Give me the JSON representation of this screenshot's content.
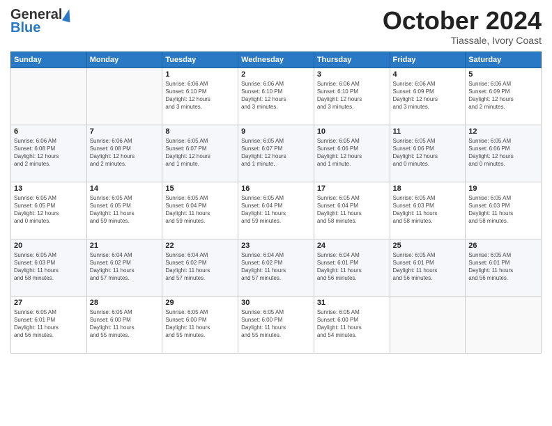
{
  "header": {
    "logo_general": "General",
    "logo_blue": "Blue",
    "month_title": "October 2024",
    "subtitle": "Tiassale, Ivory Coast"
  },
  "days_of_week": [
    "Sunday",
    "Monday",
    "Tuesday",
    "Wednesday",
    "Thursday",
    "Friday",
    "Saturday"
  ],
  "weeks": [
    [
      {
        "day": "",
        "info": ""
      },
      {
        "day": "",
        "info": ""
      },
      {
        "day": "1",
        "info": "Sunrise: 6:06 AM\nSunset: 6:10 PM\nDaylight: 12 hours\nand 3 minutes."
      },
      {
        "day": "2",
        "info": "Sunrise: 6:06 AM\nSunset: 6:10 PM\nDaylight: 12 hours\nand 3 minutes."
      },
      {
        "day": "3",
        "info": "Sunrise: 6:06 AM\nSunset: 6:10 PM\nDaylight: 12 hours\nand 3 minutes."
      },
      {
        "day": "4",
        "info": "Sunrise: 6:06 AM\nSunset: 6:09 PM\nDaylight: 12 hours\nand 3 minutes."
      },
      {
        "day": "5",
        "info": "Sunrise: 6:06 AM\nSunset: 6:09 PM\nDaylight: 12 hours\nand 2 minutes."
      }
    ],
    [
      {
        "day": "6",
        "info": "Sunrise: 6:06 AM\nSunset: 6:08 PM\nDaylight: 12 hours\nand 2 minutes."
      },
      {
        "day": "7",
        "info": "Sunrise: 6:06 AM\nSunset: 6:08 PM\nDaylight: 12 hours\nand 2 minutes."
      },
      {
        "day": "8",
        "info": "Sunrise: 6:05 AM\nSunset: 6:07 PM\nDaylight: 12 hours\nand 1 minute."
      },
      {
        "day": "9",
        "info": "Sunrise: 6:05 AM\nSunset: 6:07 PM\nDaylight: 12 hours\nand 1 minute."
      },
      {
        "day": "10",
        "info": "Sunrise: 6:05 AM\nSunset: 6:06 PM\nDaylight: 12 hours\nand 1 minute."
      },
      {
        "day": "11",
        "info": "Sunrise: 6:05 AM\nSunset: 6:06 PM\nDaylight: 12 hours\nand 0 minutes."
      },
      {
        "day": "12",
        "info": "Sunrise: 6:05 AM\nSunset: 6:06 PM\nDaylight: 12 hours\nand 0 minutes."
      }
    ],
    [
      {
        "day": "13",
        "info": "Sunrise: 6:05 AM\nSunset: 6:05 PM\nDaylight: 12 hours\nand 0 minutes."
      },
      {
        "day": "14",
        "info": "Sunrise: 6:05 AM\nSunset: 6:05 PM\nDaylight: 11 hours\nand 59 minutes."
      },
      {
        "day": "15",
        "info": "Sunrise: 6:05 AM\nSunset: 6:04 PM\nDaylight: 11 hours\nand 59 minutes."
      },
      {
        "day": "16",
        "info": "Sunrise: 6:05 AM\nSunset: 6:04 PM\nDaylight: 11 hours\nand 59 minutes."
      },
      {
        "day": "17",
        "info": "Sunrise: 6:05 AM\nSunset: 6:04 PM\nDaylight: 11 hours\nand 58 minutes."
      },
      {
        "day": "18",
        "info": "Sunrise: 6:05 AM\nSunset: 6:03 PM\nDaylight: 11 hours\nand 58 minutes."
      },
      {
        "day": "19",
        "info": "Sunrise: 6:05 AM\nSunset: 6:03 PM\nDaylight: 11 hours\nand 58 minutes."
      }
    ],
    [
      {
        "day": "20",
        "info": "Sunrise: 6:05 AM\nSunset: 6:03 PM\nDaylight: 11 hours\nand 58 minutes."
      },
      {
        "day": "21",
        "info": "Sunrise: 6:04 AM\nSunset: 6:02 PM\nDaylight: 11 hours\nand 57 minutes."
      },
      {
        "day": "22",
        "info": "Sunrise: 6:04 AM\nSunset: 6:02 PM\nDaylight: 11 hours\nand 57 minutes."
      },
      {
        "day": "23",
        "info": "Sunrise: 6:04 AM\nSunset: 6:02 PM\nDaylight: 11 hours\nand 57 minutes."
      },
      {
        "day": "24",
        "info": "Sunrise: 6:04 AM\nSunset: 6:01 PM\nDaylight: 11 hours\nand 56 minutes."
      },
      {
        "day": "25",
        "info": "Sunrise: 6:05 AM\nSunset: 6:01 PM\nDaylight: 11 hours\nand 56 minutes."
      },
      {
        "day": "26",
        "info": "Sunrise: 6:05 AM\nSunset: 6:01 PM\nDaylight: 11 hours\nand 56 minutes."
      }
    ],
    [
      {
        "day": "27",
        "info": "Sunrise: 6:05 AM\nSunset: 6:01 PM\nDaylight: 11 hours\nand 56 minutes."
      },
      {
        "day": "28",
        "info": "Sunrise: 6:05 AM\nSunset: 6:00 PM\nDaylight: 11 hours\nand 55 minutes."
      },
      {
        "day": "29",
        "info": "Sunrise: 6:05 AM\nSunset: 6:00 PM\nDaylight: 11 hours\nand 55 minutes."
      },
      {
        "day": "30",
        "info": "Sunrise: 6:05 AM\nSunset: 6:00 PM\nDaylight: 11 hours\nand 55 minutes."
      },
      {
        "day": "31",
        "info": "Sunrise: 6:05 AM\nSunset: 6:00 PM\nDaylight: 11 hours\nand 54 minutes."
      },
      {
        "day": "",
        "info": ""
      },
      {
        "day": "",
        "info": ""
      }
    ]
  ]
}
